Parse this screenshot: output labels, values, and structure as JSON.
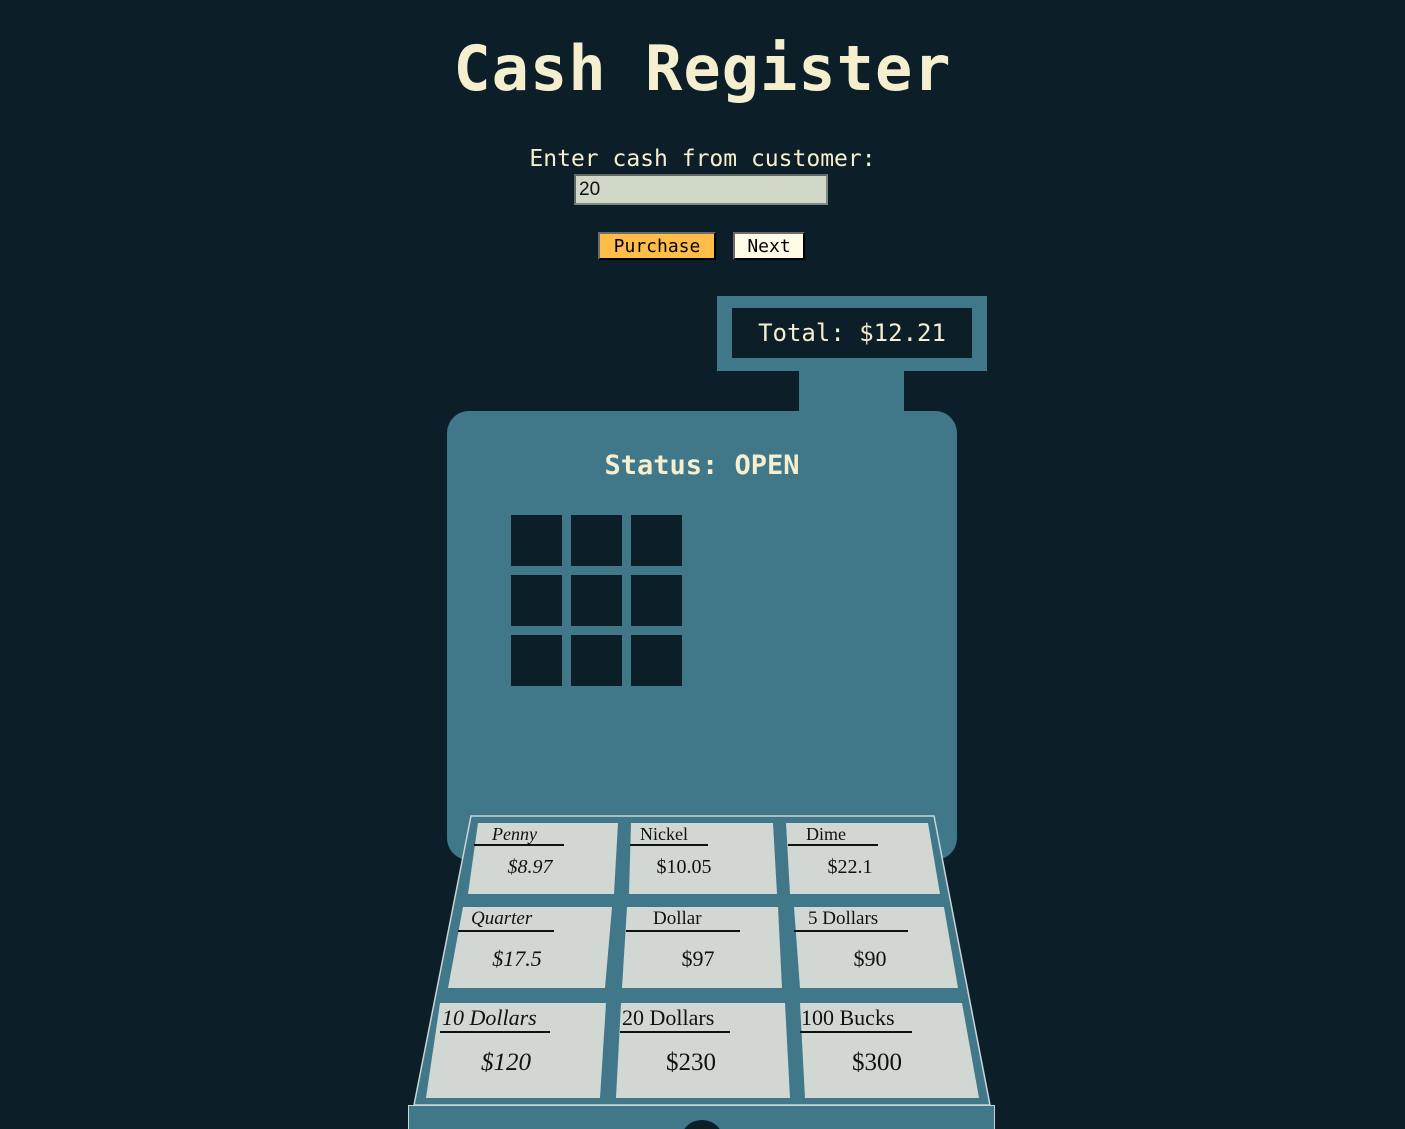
{
  "app": {
    "title": "Cash Register"
  },
  "form": {
    "cash_label": "Enter cash from customer:",
    "cash_value": "20",
    "purchase_label": "Purchase",
    "next_label": "Next"
  },
  "display": {
    "total_text": "Total: $12.21"
  },
  "register": {
    "status_text": "Status: OPEN",
    "keypad_key_count": 9
  },
  "drawer": {
    "slots": [
      {
        "label": "Penny",
        "value": "$8.97"
      },
      {
        "label": "Nickel",
        "value": "$10.05"
      },
      {
        "label": "Dime",
        "value": "$22.1"
      },
      {
        "label": "Quarter",
        "value": "$17.5"
      },
      {
        "label": "Dollar",
        "value": "$97"
      },
      {
        "label": "5 Dollars",
        "value": "$90"
      },
      {
        "label": "10 Dollars",
        "value": "$120"
      },
      {
        "label": "20 Dollars",
        "value": "$230"
      },
      {
        "label": "100 Bucks",
        "value": "$300"
      }
    ]
  },
  "colors": {
    "background": "#0c1f28",
    "register": "#40788a",
    "text": "#f5efcf",
    "purchase_button": "#fdbd48",
    "next_button": "#fffbe6",
    "slot": "#d1d8d3"
  }
}
